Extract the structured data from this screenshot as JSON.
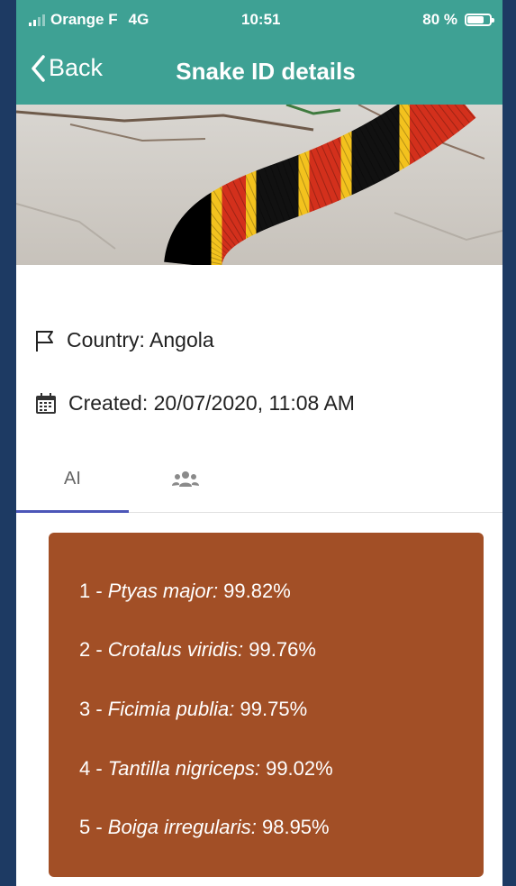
{
  "status_bar": {
    "carrier": "Orange F",
    "network": "4G",
    "time": "10:51",
    "battery": "80 %",
    "battery_level": 0.8
  },
  "nav": {
    "back_label": "Back",
    "title": "Snake ID details"
  },
  "details": {
    "country": "Country: Angola",
    "created": "Created: 20/07/2020, 11:08 AM"
  },
  "tabs": {
    "ai_label": "AI",
    "community_icon": "users-icon",
    "active": "AI"
  },
  "results": [
    {
      "rank": "1 - ",
      "species": "Ptyas major:",
      "score": " 99.82%"
    },
    {
      "rank": "2 - ",
      "species": "Crotalus viridis:",
      "score": " 99.76%"
    },
    {
      "rank": "3 - ",
      "species": "Ficimia publia:",
      "score": " 99.75%"
    },
    {
      "rank": "4 - ",
      "species": "Tantilla nigriceps:",
      "score": " 99.02%"
    },
    {
      "rank": "5 - ",
      "species": "Boiga irregularis:",
      "score": " 98.95%"
    }
  ],
  "colors": {
    "header": "#3ea194",
    "results_card": "#a24f26",
    "tab_indicator": "#4c56b8",
    "page_background": "#1d3a63"
  }
}
